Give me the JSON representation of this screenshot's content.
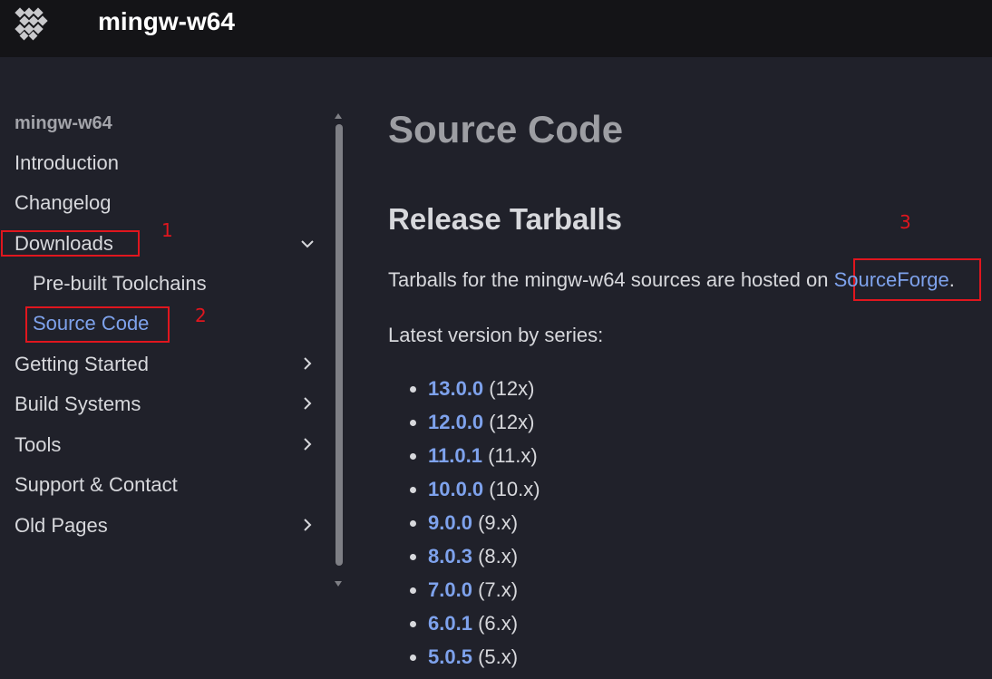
{
  "header": {
    "site_title": "mingw-w64",
    "logo_icon": "mingw-logo-icon"
  },
  "sidebar": {
    "header": "mingw-w64",
    "items": [
      {
        "label": "Introduction"
      },
      {
        "label": "Changelog"
      },
      {
        "label": "Downloads",
        "expanded": true
      },
      {
        "label": "Pre-built Toolchains"
      },
      {
        "label": "Source Code",
        "active": true
      },
      {
        "label": "Getting Started",
        "expandable": true
      },
      {
        "label": "Build Systems",
        "expandable": true
      },
      {
        "label": "Tools",
        "expandable": true
      },
      {
        "label": "Support & Contact"
      },
      {
        "label": "Old Pages",
        "expandable": true
      }
    ]
  },
  "annotations": [
    "1",
    "2",
    "3"
  ],
  "main": {
    "page_title": "Source Code",
    "section_title": "Release Tarballs",
    "intro_text": "Tarballs for the mingw-w64 sources are hosted on ",
    "intro_link": "SourceForge",
    "intro_end": ".",
    "series_label": "Latest version by series:",
    "versions": [
      {
        "version": "13.0.0",
        "series": "(12x)"
      },
      {
        "version": "12.0.0",
        "series": "(12x)"
      },
      {
        "version": "11.0.1",
        "series": "(11.x)"
      },
      {
        "version": "10.0.0",
        "series": "(10.x)"
      },
      {
        "version": "9.0.0",
        "series": "(9.x)"
      },
      {
        "version": "8.0.3",
        "series": "(8.x)"
      },
      {
        "version": "7.0.0",
        "series": "(7.x)"
      },
      {
        "version": "6.0.1",
        "series": "(6.x)"
      },
      {
        "version": "5.0.5",
        "series": "(5.x)"
      }
    ]
  },
  "colors": {
    "background": "#20212a",
    "topbar": "#141417",
    "link": "#7ea2ec",
    "annotation": "#e0161e"
  }
}
